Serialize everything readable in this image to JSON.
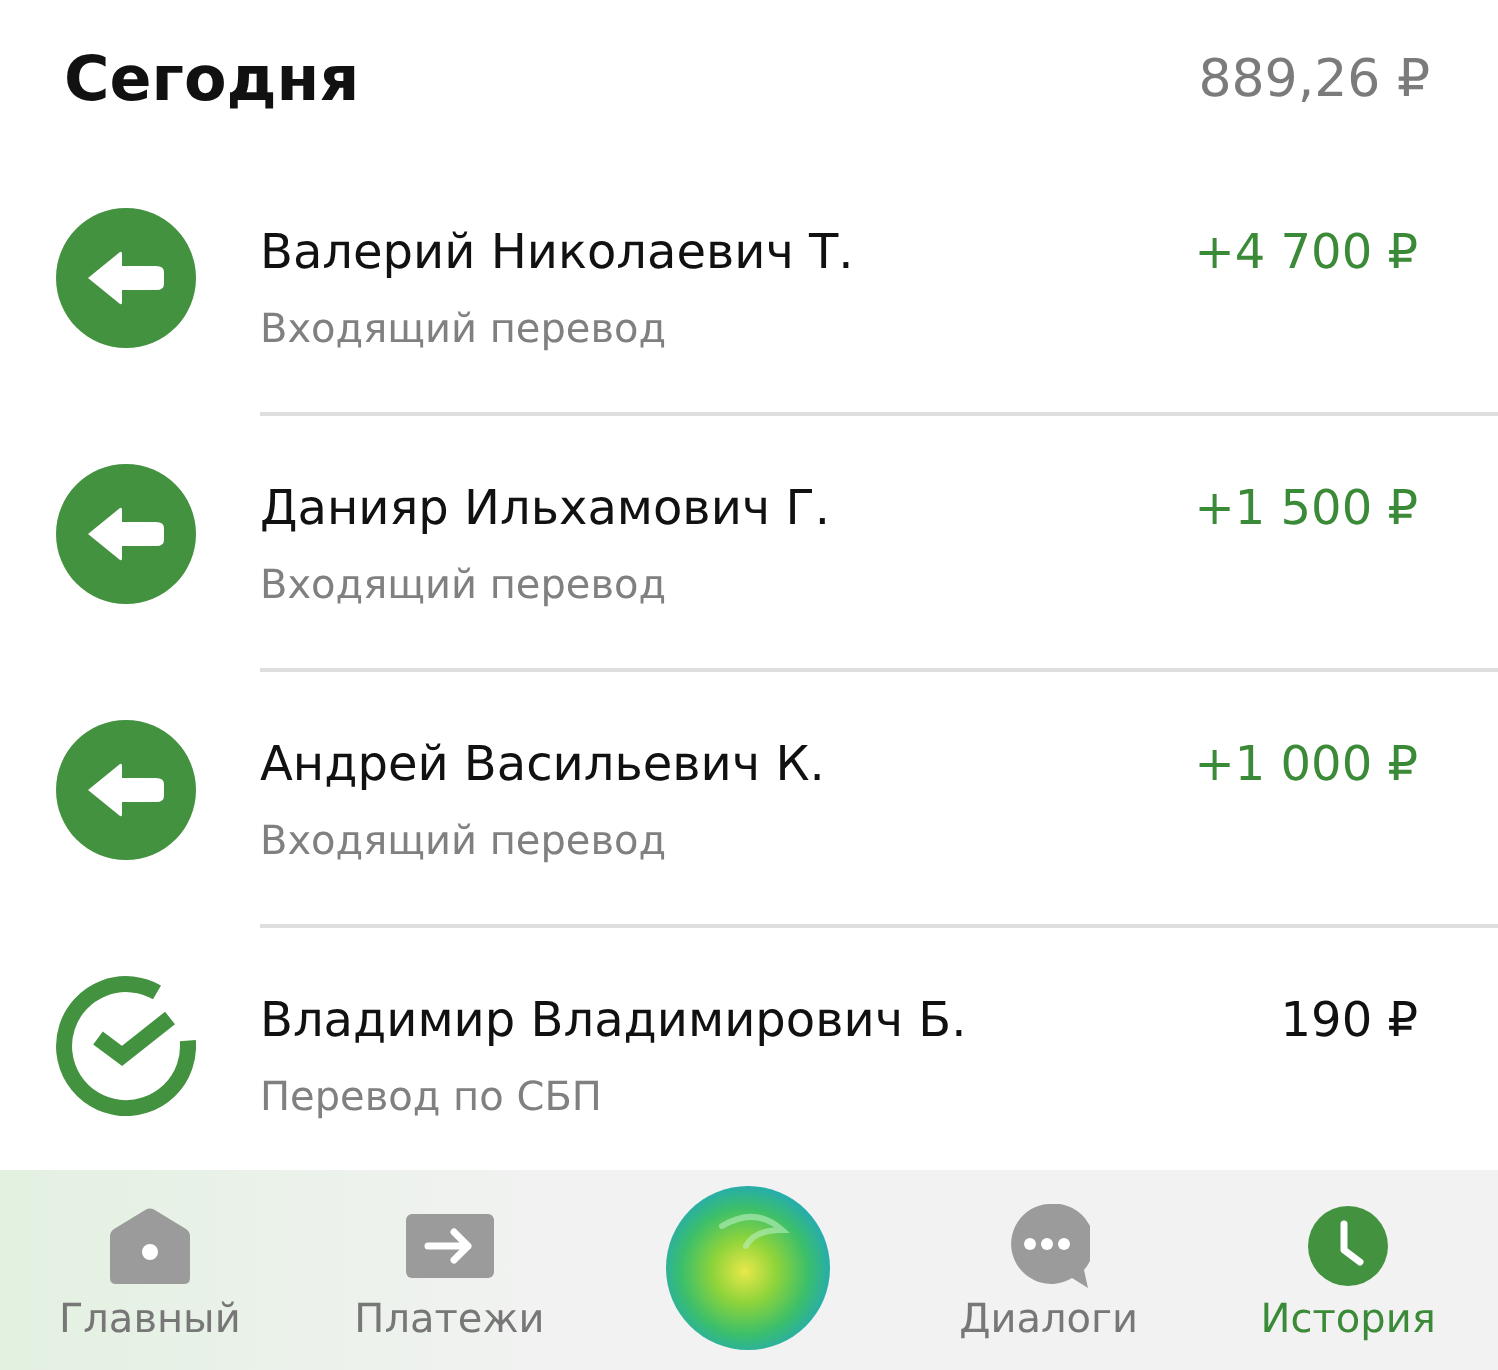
{
  "header": {
    "title": "Сегодня",
    "total": "889,26 ₽"
  },
  "transactions": [
    {
      "kind": "incoming",
      "name": "Валерий Николаевич Т.",
      "description": "Входящий перевод",
      "amount": "+4 700 ₽"
    },
    {
      "kind": "incoming",
      "name": "Данияр Ильхамович Г.",
      "description": "Входящий перевод",
      "amount": "+1 500 ₽"
    },
    {
      "kind": "incoming",
      "name": "Андрей Васильевич К.",
      "description": "Входящий перевод",
      "amount": "+1 000 ₽"
    },
    {
      "kind": "sbp",
      "name": "Владимир Владимирович Б.",
      "description": "Перевод по СБП",
      "amount": "190 ₽"
    }
  ],
  "tab_bar": [
    {
      "kind": "home",
      "label": "Главный",
      "selected": false
    },
    {
      "kind": "payments",
      "label": "Платежи",
      "selected": false
    },
    {
      "kind": "assistant",
      "selected": false
    },
    {
      "kind": "dialogs",
      "label": "Диалоги",
      "selected": false
    },
    {
      "kind": "history",
      "label": "История",
      "selected": true
    }
  ]
}
